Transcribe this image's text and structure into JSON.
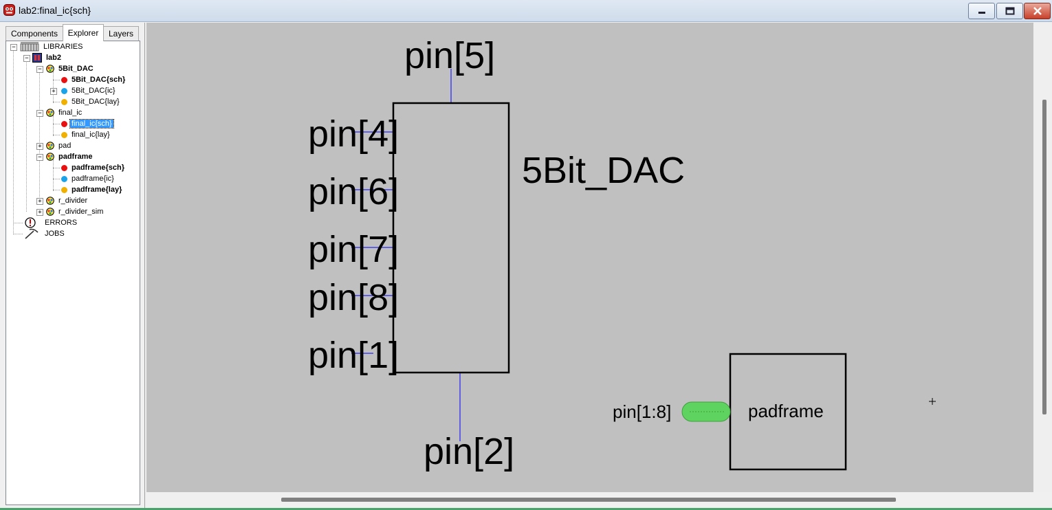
{
  "window": {
    "title": "lab2:final_ic{sch}"
  },
  "tabs": [
    {
      "label": "Components"
    },
    {
      "label": "Explorer"
    },
    {
      "label": "Layers"
    }
  ],
  "tree": [
    {
      "label": "LIBRARIES",
      "icon": "libraries-icon",
      "expanded": true
    },
    {
      "label": "lab2",
      "icon": "library-icon",
      "expanded": true,
      "bold": true
    },
    {
      "label": "5Bit_DAC",
      "icon": "cell-icon",
      "expanded": true,
      "bold": true
    },
    {
      "label": "5Bit_DAC{sch}",
      "icon": "schematic-dot",
      "bold": true
    },
    {
      "label": "5Bit_DAC{ic}",
      "icon": "icon-dot",
      "expandable": true
    },
    {
      "label": "5Bit_DAC{lay}",
      "icon": "layout-dot"
    },
    {
      "label": "final_ic",
      "icon": "cell-icon",
      "expanded": true
    },
    {
      "label": "final_ic{sch}",
      "icon": "schematic-dot",
      "selected": true
    },
    {
      "label": "final_ic{lay}",
      "icon": "layout-dot"
    },
    {
      "label": "pad",
      "icon": "cell-icon",
      "expandable": true
    },
    {
      "label": "padframe",
      "icon": "cell-icon",
      "expanded": true,
      "bold": true
    },
    {
      "label": "padframe{sch}",
      "icon": "schematic-dot",
      "bold": true
    },
    {
      "label": "padframe{ic}",
      "icon": "icon-dot"
    },
    {
      "label": "padframe{lay}",
      "icon": "layout-dot",
      "bold": true
    },
    {
      "label": "r_divider",
      "icon": "cell-icon",
      "expandable": true
    },
    {
      "label": "r_divider_sim",
      "icon": "cell-icon",
      "expandable": true
    },
    {
      "label": "ERRORS",
      "icon": "errors-icon"
    },
    {
      "label": "JOBS",
      "icon": "jobs-icon"
    }
  ],
  "schematic": {
    "dac_name": "5Bit_DAC",
    "padframe_name": "padframe",
    "pins": {
      "top": "pin[5]",
      "left": [
        "pin[4]",
        "pin[6]",
        "pin[7]",
        "pin[8]",
        "pin[1]"
      ],
      "bottom": "pin[2]",
      "bus": "pin[1:8]"
    }
  },
  "colors": {
    "canvas": "#c0c0c0",
    "wire": "#0000ff",
    "bus_pin": "#5fd35f",
    "schematic_dot": "#e81010",
    "icon_dot": "#1aa3e8",
    "layout_dot": "#f0b000",
    "selection": "#3399ff"
  }
}
